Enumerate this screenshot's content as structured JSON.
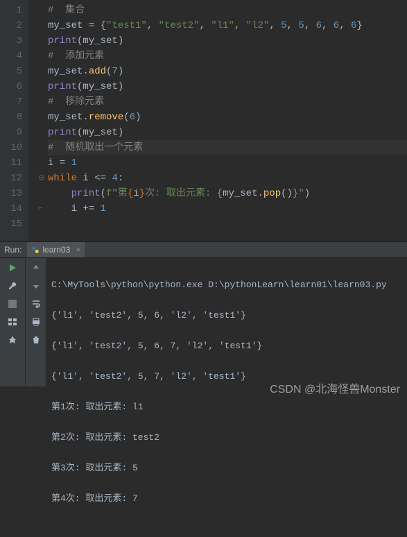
{
  "gutter": [
    "1",
    "2",
    "3",
    "4",
    "5",
    "6",
    "7",
    "8",
    "9",
    "10",
    "11",
    "12",
    "13",
    "14",
    "15"
  ],
  "code": {
    "l1": {
      "comment": "#  集合"
    },
    "l2": {
      "v": "my_set",
      "op": " = ",
      "s1": "\"test1\"",
      "s2": "\"test2\"",
      "s3": "\"l1\"",
      "s4": "\"l2\"",
      "n1": "5",
      "n2": "5",
      "n3": "6",
      "n4": "6",
      "n5": "6"
    },
    "l3": {
      "fn": "print",
      "v": "my_set"
    },
    "l4": {
      "comment": "#  添加元素"
    },
    "l5": {
      "v": "my_set",
      "m": "add",
      "n": "7"
    },
    "l6": {
      "fn": "print",
      "v": "my_set"
    },
    "l7": {
      "comment": "#  移除元素"
    },
    "l8": {
      "v": "my_set",
      "m": "remove",
      "n": "6"
    },
    "l9": {
      "fn": "print",
      "v": "my_set"
    },
    "l10": {
      "comment": "#  随机取出一个元素"
    },
    "l11": {
      "v": "i",
      "op": " = ",
      "n": "1"
    },
    "l12": {
      "kw": "while",
      "v": "i",
      "op": " <= ",
      "n": "4"
    },
    "l13": {
      "fn": "print",
      "fpre": "f\"第",
      "iv": "i",
      "mid": "次: 取出元素: ",
      "sv": "my_set",
      "m": "pop",
      "post": "\""
    },
    "l14": {
      "v": "i",
      "op": " += ",
      "n": "1"
    }
  },
  "run": {
    "label": "Run:",
    "tab": "learn03",
    "lines": [
      "C:\\MyTools\\python\\python.exe D:\\pythonLearn\\learn01\\learn03.py",
      "{'l1', 'test2', 5, 6, 'l2', 'test1'}",
      "{'l1', 'test2', 5, 6, 7, 'l2', 'test1'}",
      "{'l1', 'test2', 5, 7, 'l2', 'test1'}",
      "第1次: 取出元素: l1",
      "第2次: 取出元素: test2",
      "第3次: 取出元素: 5",
      "第4次: 取出元素: 7"
    ]
  },
  "watermark": "CSDN @北海怪兽Monster"
}
